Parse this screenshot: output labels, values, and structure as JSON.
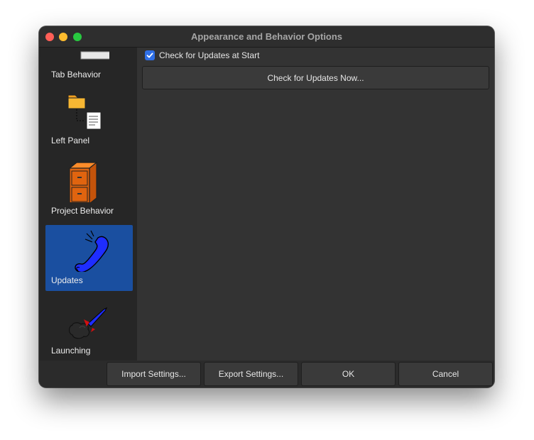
{
  "window": {
    "title": "Appearance and Behavior Options"
  },
  "sidebar": {
    "items": [
      {
        "label": "Tab Behavior",
        "icon": "tab-behavior-icon",
        "selected": false
      },
      {
        "label": "Left Panel",
        "icon": "folder-document-icon",
        "selected": false
      },
      {
        "label": "Project Behavior",
        "icon": "filing-cabinet-icon",
        "selected": false
      },
      {
        "label": "Updates",
        "icon": "telephone-icon",
        "selected": true
      },
      {
        "label": "Launching",
        "icon": "rocket-launch-icon",
        "selected": false
      }
    ]
  },
  "updates": {
    "check_at_start_label": "Check for Updates at Start",
    "check_at_start_checked": true,
    "check_now_label": "Check for Updates Now..."
  },
  "footer": {
    "import_label": "Import Settings...",
    "export_label": "Export Settings...",
    "ok_label": "OK",
    "cancel_label": "Cancel"
  },
  "colors": {
    "selection": "#1a4fa0",
    "checkbox": "#2f6fe6"
  }
}
